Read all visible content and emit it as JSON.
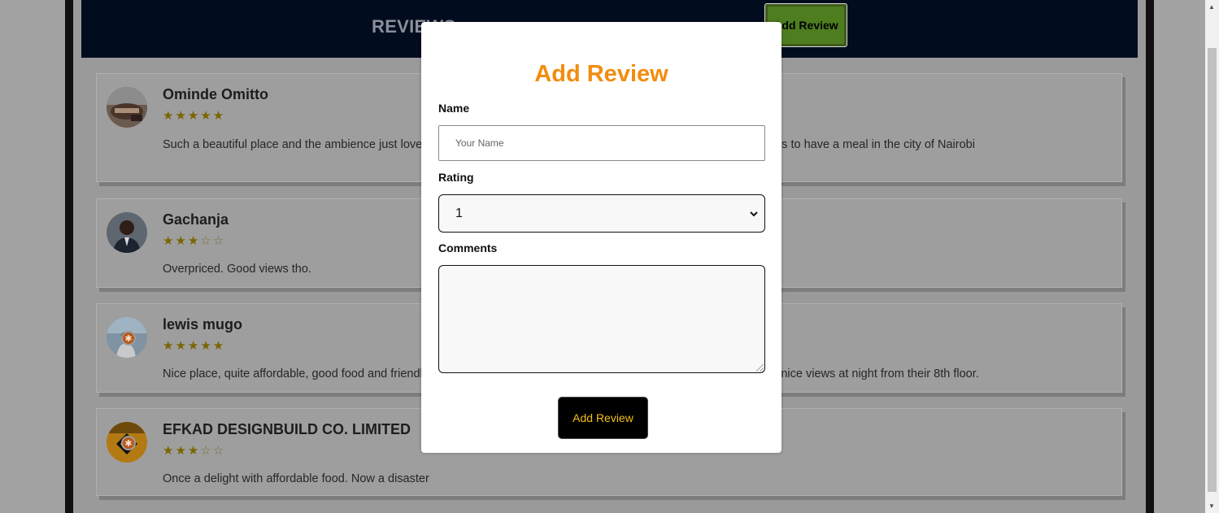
{
  "header": {
    "title": "REVIEWS",
    "add_review_button": "Add Review"
  },
  "reviews": [
    {
      "name": "Ominde Omitto",
      "stars_filled": "★★★★★",
      "stars_empty": "",
      "rating": 5,
      "text": "Such a beautiful place and the ambience just lovely and the staff so friendly. I would recommend it to anyone who wants to have a meal in the city of Nairobi"
    },
    {
      "name": "Gachanja",
      "stars_filled": "★★★",
      "stars_empty": "☆☆",
      "rating": 3,
      "text": "Overpriced. Good views tho."
    },
    {
      "name": "lewis mugo",
      "stars_filled": "★★★★★",
      "stars_empty": "",
      "rating": 5,
      "text": "Nice place, quite affordable, good food and friendly staff. Fast service too, no waiting long for food coming to you. Also nice views at night from their 8th floor."
    },
    {
      "name": "EFKAD DESIGNBUILD CO. LIMITED",
      "stars_filled": "★★★",
      "stars_empty": "☆☆",
      "rating": 3,
      "text": "Once a delight with affordable food. Now a disaster"
    }
  ],
  "modal": {
    "title": "Add Review",
    "name_label": "Name",
    "name_placeholder": "Your Name",
    "rating_label": "Rating",
    "rating_value": "1",
    "comments_label": "Comments",
    "submit_label": "Add Review"
  },
  "colors": {
    "header_bg": "#020c1f",
    "accent_orange": "#f28c0f",
    "submit_text": "#f3c118",
    "add_button_green": "#4d7d1f"
  }
}
